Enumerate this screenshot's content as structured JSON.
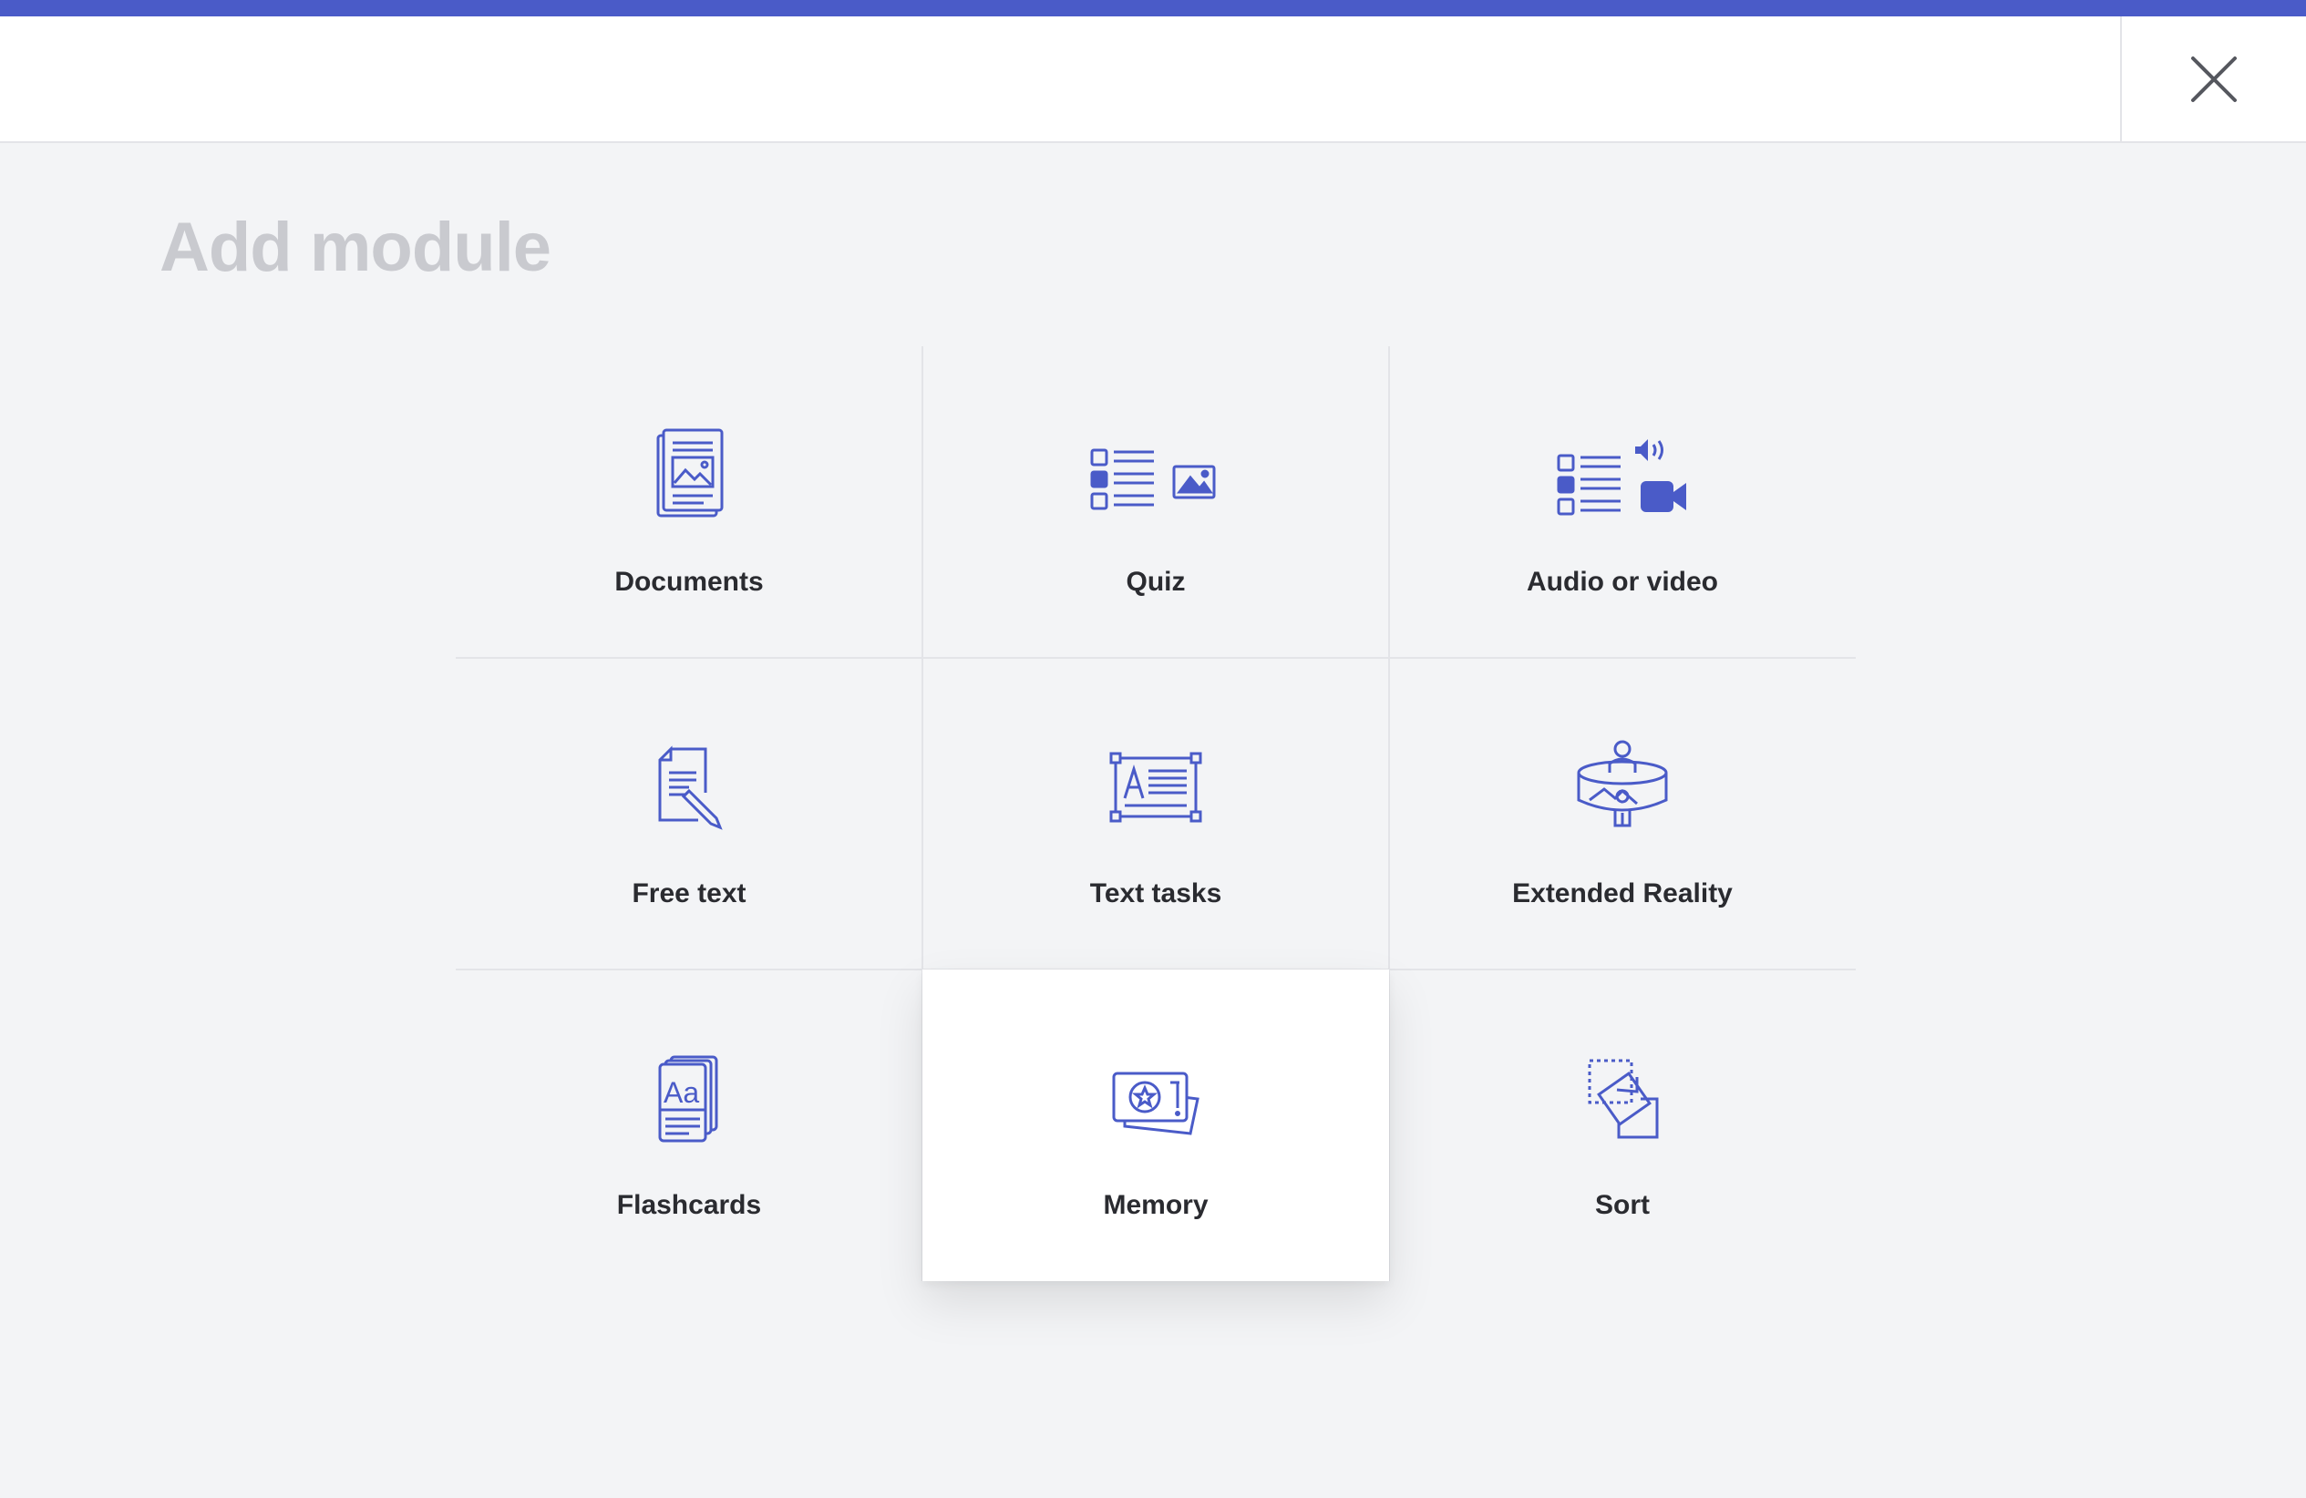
{
  "page": {
    "title": "Add module"
  },
  "header": {
    "close_icon": "close-icon"
  },
  "theme": {
    "accent": "#4a5bc8",
    "background": "#f3f4f6",
    "title_color": "#c9cacf"
  },
  "modules": [
    {
      "label": "Documents",
      "icon": "documents-icon"
    },
    {
      "label": "Quiz",
      "icon": "quiz-icon"
    },
    {
      "label": "Audio or video",
      "icon": "audio-video-icon"
    },
    {
      "label": "Free text",
      "icon": "free-text-icon"
    },
    {
      "label": "Text tasks",
      "icon": "text-tasks-icon"
    },
    {
      "label": "Extended Reality",
      "icon": "extended-reality-icon"
    },
    {
      "label": "Flashcards",
      "icon": "flashcards-icon"
    },
    {
      "label": "Memory",
      "icon": "memory-icon",
      "selected": true
    },
    {
      "label": "Sort",
      "icon": "sort-icon"
    }
  ]
}
